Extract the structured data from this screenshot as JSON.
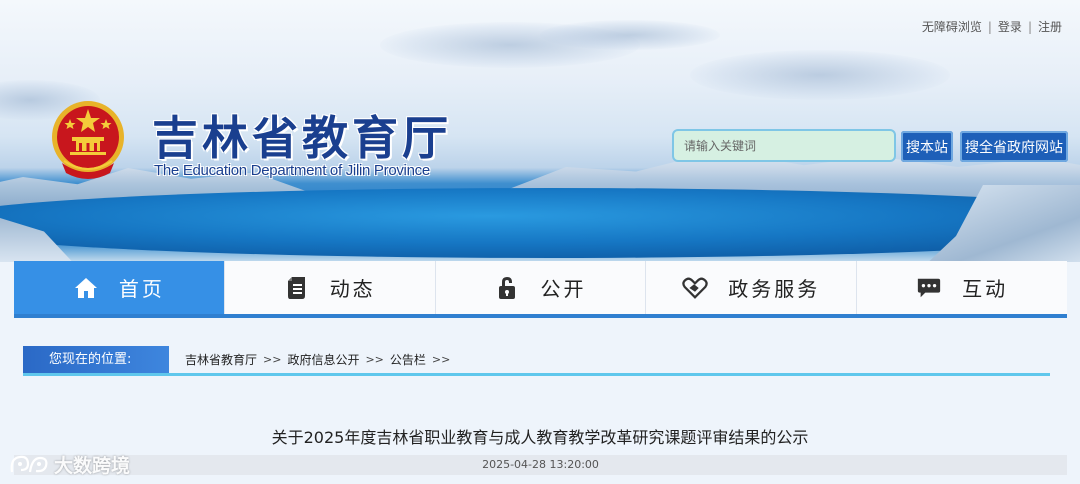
{
  "top_links": {
    "accessibility": "无障碍浏览",
    "login": "登录",
    "register": "注册",
    "separator": "|"
  },
  "header": {
    "title": "吉林省教育厅",
    "subtitle": "The Education Department of Jilin Province"
  },
  "search": {
    "placeholder": "请输入关键词",
    "search_site_label": "搜本站",
    "search_province_label": "搜全省政府网站"
  },
  "nav": {
    "items": [
      {
        "label": "首页",
        "icon": "home-icon",
        "active": true
      },
      {
        "label": "动态",
        "icon": "document-icon",
        "active": false
      },
      {
        "label": "公开",
        "icon": "lock-icon",
        "active": false
      },
      {
        "label": "政务服务",
        "icon": "heart-hand-icon",
        "active": false
      },
      {
        "label": "互动",
        "icon": "chat-bubble-icon",
        "active": false
      }
    ]
  },
  "breadcrumb": {
    "label": "您现在的位置:",
    "items": [
      "吉林省教育厅",
      "政府信息公开",
      "公告栏"
    ],
    "separator": ">>"
  },
  "article": {
    "title": "关于2025年度吉林省职业教育与成人教育教学改革研究课题评审结果的公示",
    "datetime": "2025-04-28 13:20:00"
  },
  "watermark": {
    "text": "大数跨境"
  },
  "colors": {
    "nav_active": "#3690e6",
    "title_blue": "#1a3f8f",
    "button_blue": "#1d5fb8",
    "crumb_accent": "#5fc7ec"
  }
}
